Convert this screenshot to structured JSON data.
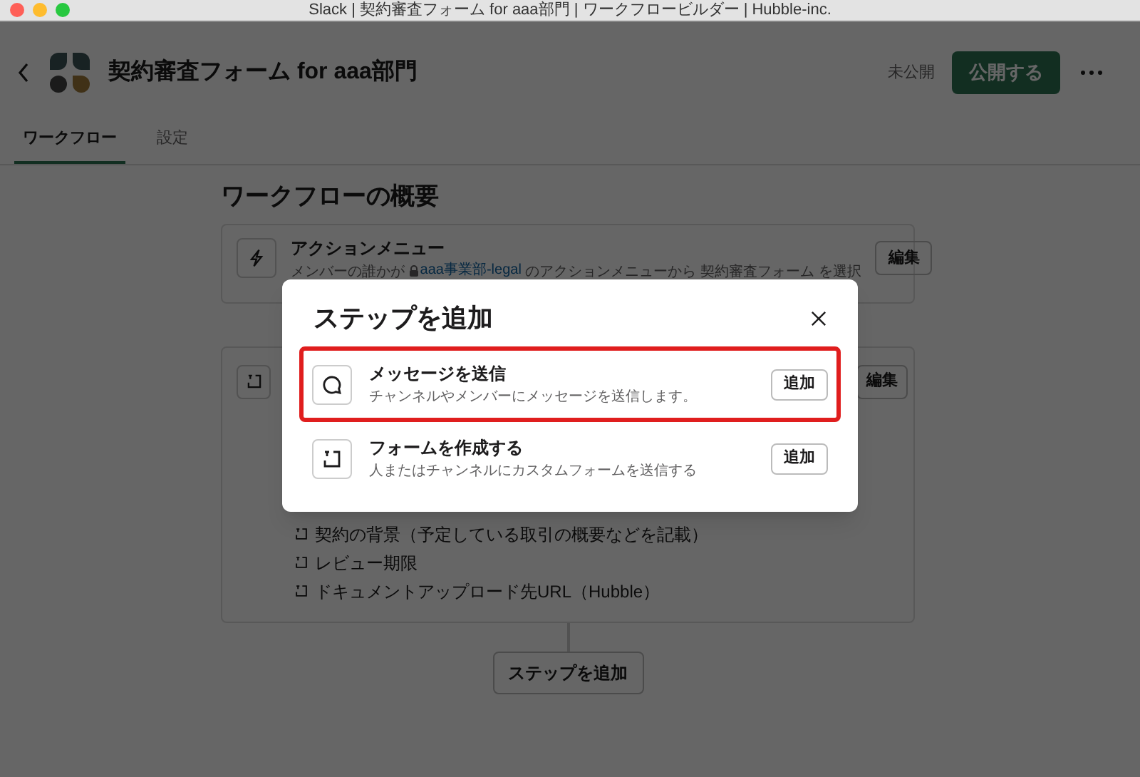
{
  "window": {
    "title": "Slack | 契約審査フォーム for aaa部門 | ワークフロービルダー | Hubble-inc."
  },
  "header": {
    "title": "契約審査フォーム for aaa部門",
    "status": "未公開",
    "publish_button": "公開する"
  },
  "tabs": [
    {
      "label": "ワークフロー",
      "selected": true
    },
    {
      "label": "設定",
      "selected": false
    }
  ],
  "overview": {
    "heading": "ワークフローの概要",
    "trigger": {
      "title": "アクションメニュー",
      "description_before": "メンバーの誰かが",
      "channel": "aaa事業部-legal",
      "description_after": "のアクションメニューから 契約審査フォーム を選択",
      "edit_button": "編集"
    },
    "form_step": {
      "edit_button": "編集",
      "fields": [
        "契約の背景（予定している取引の概要などを記載）",
        "レビュー期限",
        "ドキュメントアップロード先URL（Hubble）"
      ]
    },
    "add_step_button": "ステップを追加"
  },
  "dialog": {
    "title": "ステップを追加",
    "steps": [
      {
        "kind": "message",
        "title": "メッセージを送信",
        "description": "チャンネルやメンバーにメッセージを送信します。",
        "add_button": "追加",
        "selected": true
      },
      {
        "kind": "form",
        "title": "フォームを作成する",
        "description": "人またはチャンネルにカスタムフォームを送信する",
        "add_button": "追加",
        "selected": false
      }
    ]
  }
}
